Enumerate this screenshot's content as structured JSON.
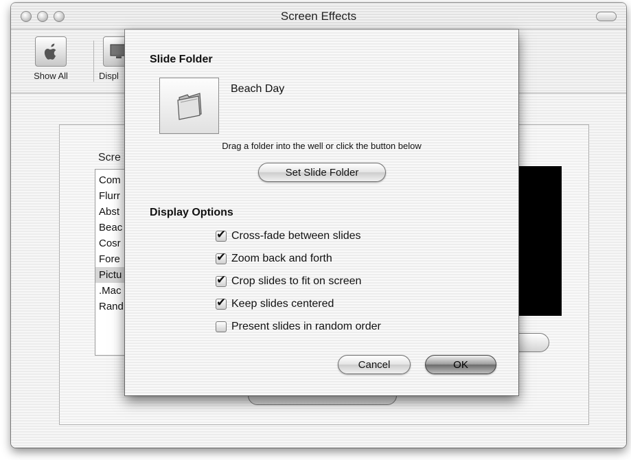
{
  "window": {
    "title": "Screen Effects"
  },
  "toolbar": {
    "items": [
      {
        "label": "Show All",
        "icon": "apple-icon"
      },
      {
        "label": "Displ",
        "icon": "display-icon"
      }
    ]
  },
  "background": {
    "saver_label": "Scre",
    "saver_list": [
      {
        "label": "Com",
        "selected": false
      },
      {
        "label": "Flurr",
        "selected": false
      },
      {
        "label": "Abst",
        "selected": false
      },
      {
        "label": "Beac",
        "selected": false
      },
      {
        "label": "Cosr",
        "selected": false
      },
      {
        "label": "Fore",
        "selected": false
      },
      {
        "label": "Pictu",
        "selected": true
      },
      {
        "label": ".Mac",
        "selected": false
      },
      {
        "label": "Rand",
        "selected": false
      }
    ]
  },
  "sheet": {
    "slide_folder_heading": "Slide Folder",
    "folder_name": "Beach Day",
    "hint": "Drag a folder into the well or click the button below",
    "set_folder_button": "Set Slide Folder",
    "display_options_heading": "Display Options",
    "options": [
      {
        "label": "Cross-fade between slides",
        "checked": true
      },
      {
        "label": "Zoom back and forth",
        "checked": true
      },
      {
        "label": "Crop slides to fit on screen",
        "checked": true
      },
      {
        "label": "Keep slides centered",
        "checked": true
      },
      {
        "label": "Present slides in random order",
        "checked": false
      }
    ],
    "cancel_button": "Cancel",
    "ok_button": "OK"
  }
}
